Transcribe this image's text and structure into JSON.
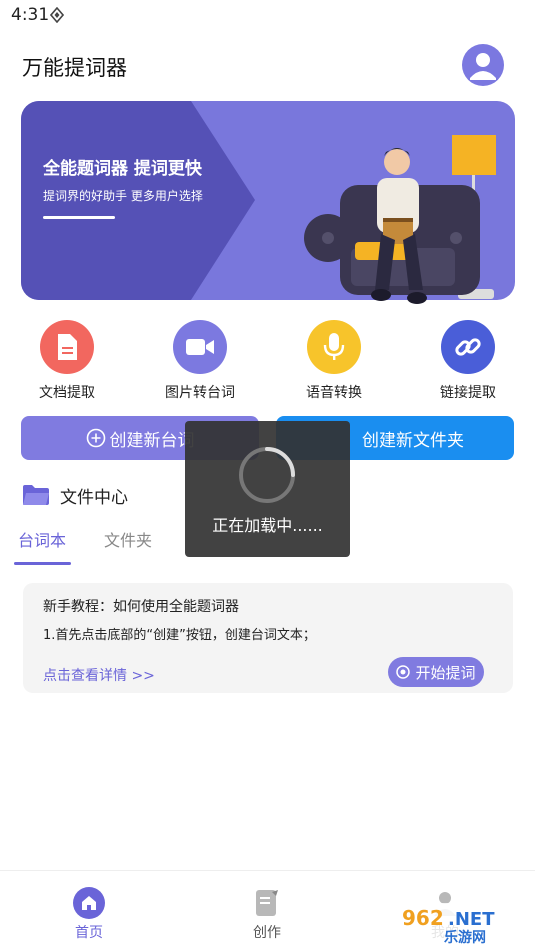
{
  "status_bar": {
    "time": "4:31",
    "icons": [
      "location-diamond-icon"
    ]
  },
  "header": {
    "title": "万能提词器",
    "avatar_icon": "user-icon"
  },
  "banner": {
    "title": "全能题词器 提词更快",
    "subtitle": "提词界的好助手 更多用户选择"
  },
  "features": [
    {
      "label": "文档提取",
      "icon": "document-icon",
      "color": "#f2675f"
    },
    {
      "label": "图片转台词",
      "icon": "video-camera-icon",
      "color": "#7c79e0"
    },
    {
      "label": "语音转换",
      "icon": "microphone-icon",
      "color": "#f7c42b"
    },
    {
      "label": "链接提取",
      "icon": "link-icon",
      "color": "#4a5ed8"
    }
  ],
  "actions": {
    "create_script": "创建新台词",
    "create_folder": "创建新文件夹"
  },
  "file_center": {
    "title": "文件中心",
    "icon": "folder-icon",
    "tabs": [
      {
        "label": "台词本",
        "active": true
      },
      {
        "label": "文件夹",
        "active": false
      }
    ]
  },
  "card": {
    "title": "新手教程：如何使用全能题词器",
    "description": "1.首先点击底部的“创建”按钮，创建台词文本；",
    "link": "点击查看详情 >>",
    "button": "开始提词"
  },
  "loading": {
    "text": "正在加载中......"
  },
  "bottom_nav": [
    {
      "label": "首页",
      "icon": "home-icon",
      "active": true
    },
    {
      "label": "创作",
      "icon": "edit-document-icon",
      "active": false
    },
    {
      "label": "我的",
      "icon": "profile-icon",
      "active": false
    }
  ],
  "watermark": {
    "text_top": "962.NET",
    "text_bottom": "乐游网"
  },
  "colors": {
    "accent": "#6a64d8",
    "primary_blue": "#1a8ef0",
    "banner": "#7977dc"
  }
}
